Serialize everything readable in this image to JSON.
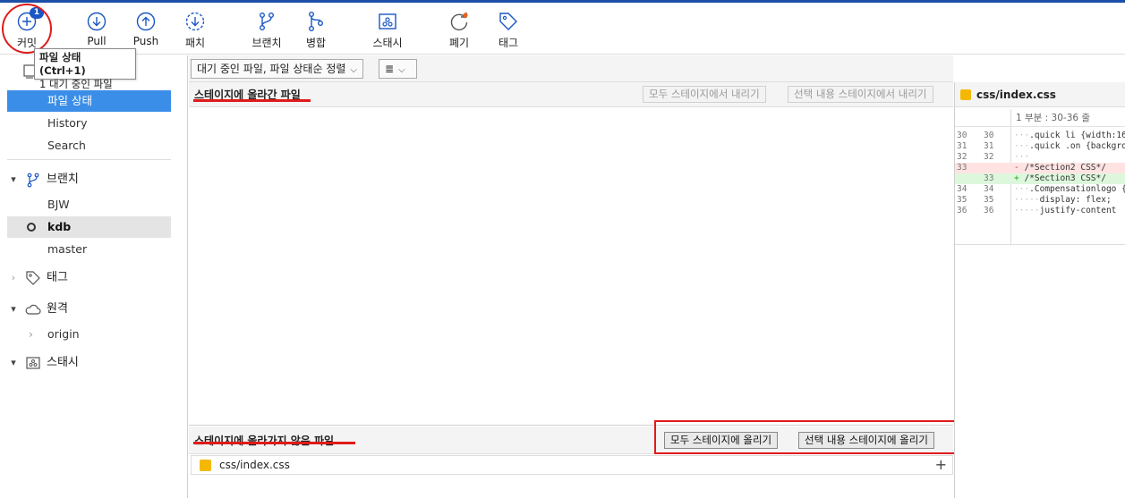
{
  "toolbar": {
    "commit": {
      "label": "커밋",
      "badge": "1"
    },
    "pull": "Pull",
    "push": "Push",
    "patch": "패치",
    "branch": "브랜치",
    "merge": "병합",
    "stash": "스태시",
    "discard": "폐기",
    "tag": "태그"
  },
  "tooltip": {
    "title": "파일 상태 (Ctrl+1)",
    "subtitle": "1 대기 중인 파일"
  },
  "sidebar": {
    "workspace_items": [
      "파일 상태",
      "History",
      "Search"
    ],
    "branches": {
      "label": "브랜치",
      "items": [
        "BJW",
        "kdb",
        "master"
      ],
      "current": "kdb"
    },
    "tags": {
      "label": "태그"
    },
    "remotes": {
      "label": "원격",
      "items": [
        "origin"
      ]
    },
    "stashes": {
      "label": "스태시"
    }
  },
  "filter": {
    "dropdown": "대기 중인 파일, 파일 상태순 정렬",
    "view_icon": "list-icon"
  },
  "staged": {
    "title": "스테이지에 올라간 파일",
    "unstage_all": "모두 스테이지에서 내리기",
    "unstage_selected": "선택 내용 스테이지에서 내리기"
  },
  "unstaged": {
    "title": "스테이지에 올라가지 않은 파일",
    "stage_all": "모두 스테이지에 올리기",
    "stage_selected": "선택 내용 스테이지에 올리기",
    "files": [
      {
        "name": "css/index.css",
        "status": "modified"
      }
    ]
  },
  "diff": {
    "file": "css/index.css",
    "hunk": "1 부분 : 30-36 줄",
    "lines": [
      {
        "old": "30",
        "new": "30",
        "type": "ctx",
        "text": ".quick li {width:16"
      },
      {
        "old": "31",
        "new": "31",
        "type": "ctx",
        "text": ".quick .on {backgrou"
      },
      {
        "old": "32",
        "new": "32",
        "type": "ctx",
        "text": ""
      },
      {
        "old": "33",
        "new": "",
        "type": "del",
        "text": "/*Section2 CSS*/"
      },
      {
        "old": "",
        "new": "33",
        "type": "add",
        "text": "/*Section3 CSS*/"
      },
      {
        "old": "34",
        "new": "34",
        "type": "ctx",
        "text": ".Compensationlogo {"
      },
      {
        "old": "35",
        "new": "35",
        "type": "ctx",
        "text": "display: flex;"
      },
      {
        "old": "36",
        "new": "36",
        "type": "ctx",
        "text": "justify-content"
      }
    ]
  },
  "colors": {
    "accent": "#3b8ee8",
    "badge": "#1a56c4",
    "annotation": "#e01b1b",
    "file_modified": "#f5b800"
  }
}
